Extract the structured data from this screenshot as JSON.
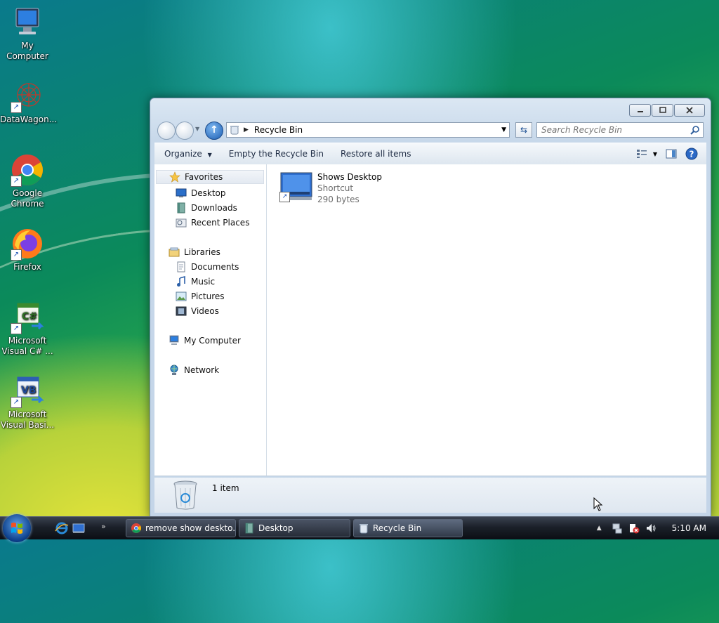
{
  "desktop": {
    "icons": [
      {
        "label": "My Computer"
      },
      {
        "label": "DataWagon..."
      },
      {
        "label": "Google Chrome"
      },
      {
        "label": "Firefox"
      },
      {
        "label": "Microsoft Visual C# ..."
      },
      {
        "label": "Microsoft Visual Basi..."
      }
    ]
  },
  "window": {
    "address": {
      "breadcrumb": "Recycle Bin"
    },
    "search": {
      "placeholder": "Search Recycle Bin"
    },
    "toolbar": {
      "organize": "Organize",
      "empty": "Empty the Recycle Bin",
      "restore": "Restore all items"
    },
    "navpane": {
      "favorites": "Favorites",
      "desktop": "Desktop",
      "downloads": "Downloads",
      "recent_places": "Recent Places",
      "libraries": "Libraries",
      "documents": "Documents",
      "music": "Music",
      "pictures": "Pictures",
      "videos": "Videos",
      "my_computer": "My Computer",
      "network": "Network"
    },
    "files": [
      {
        "name": "Shows Desktop",
        "type": "Shortcut",
        "size": "290 bytes"
      }
    ],
    "details": {
      "count": "1 item"
    }
  },
  "taskbar": {
    "tasks": [
      {
        "label": "remove show deskto..."
      },
      {
        "label": "Desktop"
      },
      {
        "label": "Recycle Bin"
      }
    ],
    "clock": "5:10 AM"
  },
  "colors": {
    "accent": "#1b5db3",
    "window_frame": "#c7d8ea",
    "taskbar": "#1b2029"
  }
}
